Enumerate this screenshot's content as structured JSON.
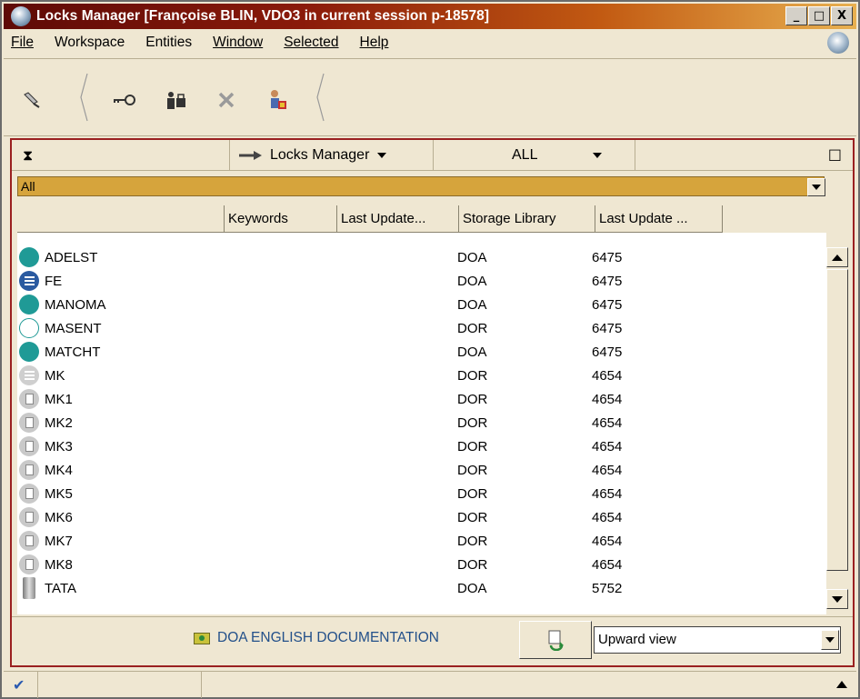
{
  "window": {
    "title": "Locks Manager [Françoise BLIN, VDO3 in current session p-18578]",
    "controls": {
      "minimize": "_",
      "maximize": "□",
      "close": "X"
    }
  },
  "menu": {
    "items": [
      "File",
      "Workspace",
      "Entities",
      "Window",
      "Selected",
      "Help"
    ]
  },
  "toolbar": {
    "tools": [
      "probe-icon",
      "key-icon",
      "user-lock-icon",
      "delete-icon",
      "user-config-icon"
    ]
  },
  "panel": {
    "collapse_glyph": "⧗",
    "view_name": "Locks Manager",
    "scope": "ALL",
    "maximize_glyph": "□",
    "filter_value": "All",
    "columns": [
      "Keywords",
      "Last Update...",
      "Storage Library",
      "Last Update ..."
    ],
    "rows": [
      {
        "name": "ADELST",
        "library": "DOA",
        "update": "6475",
        "icon": "teal-circle"
      },
      {
        "name": "FE",
        "library": "DOA",
        "update": "6475",
        "icon": "blue-list"
      },
      {
        "name": "MANOMA",
        "library": "DOA",
        "update": "6475",
        "icon": "teal-circle"
      },
      {
        "name": "MASENT",
        "library": "DOR",
        "update": "6475",
        "icon": "white-circle"
      },
      {
        "name": "MATCHT",
        "library": "DOA",
        "update": "6475",
        "icon": "teal-circle"
      },
      {
        "name": "MK",
        "library": "DOR",
        "update": "4654",
        "icon": "gray-list"
      },
      {
        "name": "MK1",
        "library": "DOR",
        "update": "4654",
        "icon": "gray-doc"
      },
      {
        "name": "MK2",
        "library": "DOR",
        "update": "4654",
        "icon": "gray-doc"
      },
      {
        "name": "MK3",
        "library": "DOR",
        "update": "4654",
        "icon": "gray-doc"
      },
      {
        "name": "MK4",
        "library": "DOR",
        "update": "4654",
        "icon": "gray-doc"
      },
      {
        "name": "MK5",
        "library": "DOR",
        "update": "4654",
        "icon": "gray-doc"
      },
      {
        "name": "MK6",
        "library": "DOR",
        "update": "4654",
        "icon": "gray-doc"
      },
      {
        "name": "MK7",
        "library": "DOR",
        "update": "4654",
        "icon": "gray-doc"
      },
      {
        "name": "MK8",
        "library": "DOR",
        "update": "4654",
        "icon": "gray-doc"
      },
      {
        "name": "TATA",
        "library": "DOA",
        "update": "5752",
        "icon": "gray-cylinder"
      }
    ],
    "footer": {
      "doc_link": "DOA ENGLISH DOCUMENTATION",
      "view_mode": "Upward view"
    }
  },
  "status": {
    "check_glyph": "✔"
  },
  "colors": {
    "title_start": "#5e0a06",
    "title_end": "#e8b050",
    "panel_border": "#9a2020",
    "filter_bar": "#d6a43c",
    "teal": "#1f9a96",
    "link": "#23508a"
  }
}
